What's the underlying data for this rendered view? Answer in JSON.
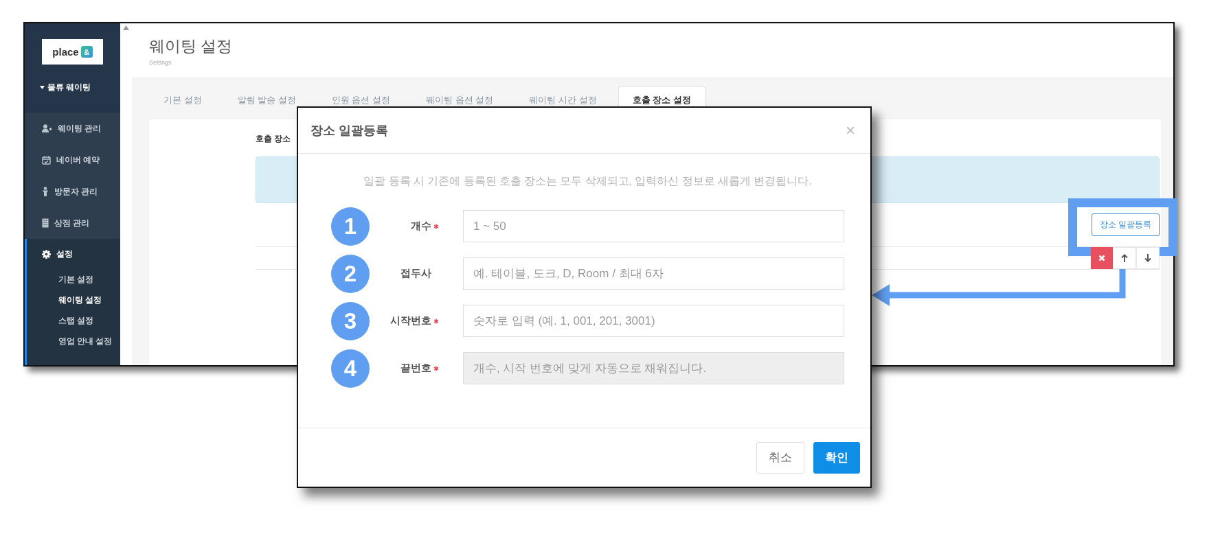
{
  "sidebar": {
    "logo": {
      "text": "place",
      "badge": "&"
    },
    "group": "물류 웨이팅",
    "items": [
      {
        "label": "웨이팅 관리",
        "selected": false
      },
      {
        "label": "네이버 예약",
        "selected": false
      },
      {
        "label": "방문자 관리",
        "selected": false
      },
      {
        "label": "상점 관리",
        "selected": false
      },
      {
        "label": "설정",
        "selected": true,
        "children": [
          {
            "label": "기본 설정",
            "selected": false
          },
          {
            "label": "웨이팅 설정",
            "selected": true
          },
          {
            "label": "스탭 설정",
            "selected": false
          },
          {
            "label": "영업 안내 설정",
            "selected": false
          }
        ]
      }
    ]
  },
  "header": {
    "title": "웨이팅 설정",
    "subtitle": "Settings"
  },
  "tabs": [
    {
      "label": "기본 설정",
      "selected": false
    },
    {
      "label": "알림 발송 설정",
      "selected": false
    },
    {
      "label": "인원 옵션 설정",
      "selected": false
    },
    {
      "label": "웨이팅 옵션 설정",
      "selected": false
    },
    {
      "label": "웨이팅 시간 설정",
      "selected": false
    },
    {
      "label": "호출 장소 설정",
      "selected": true
    }
  ],
  "panel": {
    "label": "호출 장소",
    "bulk_button": "장소 일괄등록"
  },
  "modal": {
    "title": "장소 일괄등록",
    "close": "×",
    "notice": "일괄 등록 시 기존에 등록된 호출 장소는 모두 삭제되고, 입력하신 정보로 새롭게 변경됩니다.",
    "fields": [
      {
        "number": "1",
        "label": "개수",
        "required": true,
        "placeholder": "1 ~ 50",
        "disabled": false
      },
      {
        "number": "2",
        "label": "접두사",
        "required": false,
        "placeholder": "예. 테이블, 도크, D, Room / 최대 6자",
        "disabled": false
      },
      {
        "number": "3",
        "label": "시작번호",
        "required": true,
        "placeholder": "숫자로 입력 (예. 1, 001, 201, 3001)",
        "disabled": false
      },
      {
        "number": "4",
        "label": "끝번호",
        "required": true,
        "placeholder": "개수, 시작 번호에 맞게 자동으로 채워집니다.",
        "disabled": true
      }
    ],
    "buttons": [
      {
        "label": "취소",
        "kind": "secondary"
      },
      {
        "label": "확인",
        "kind": "primary"
      }
    ]
  }
}
